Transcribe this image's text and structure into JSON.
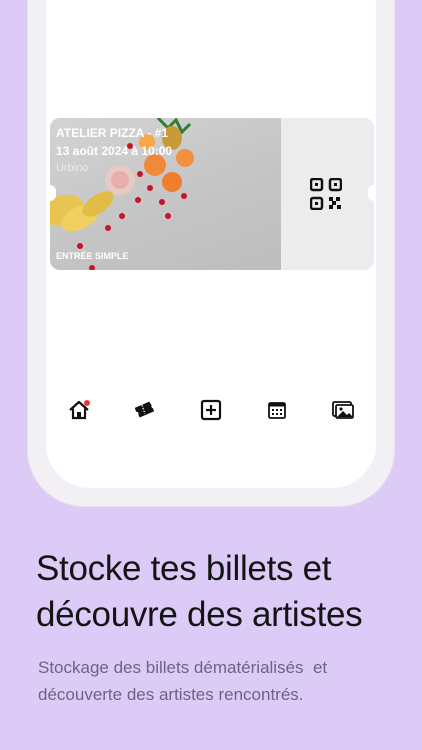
{
  "ticket": {
    "title": "ATELIER PIZZA - #1",
    "datetime": "13 août 2024 à 10:00",
    "city": "Urbino",
    "type": "ENTRÉE SIMPLE"
  },
  "ticket_behind": {
    "type": "ENTRÉE SIMPLE",
    "status_color": "#4caf50"
  },
  "nav": {
    "items": [
      {
        "icon": "home-icon",
        "active": true
      },
      {
        "icon": "tickets-icon"
      },
      {
        "icon": "add-icon"
      },
      {
        "icon": "calendar-icon"
      },
      {
        "icon": "gallery-icon"
      }
    ]
  },
  "promo": {
    "headline_line1": "Stocke tes billets et",
    "headline_line2": "découvre des artistes",
    "subtitle_line1": "Stockage des billets dématérialisés  et",
    "subtitle_line2": "découverte des artistes rencontrés."
  },
  "colors": {
    "background": "#dccbf7",
    "accent_green": "#4caf50",
    "badge_red": "#e53935"
  }
}
